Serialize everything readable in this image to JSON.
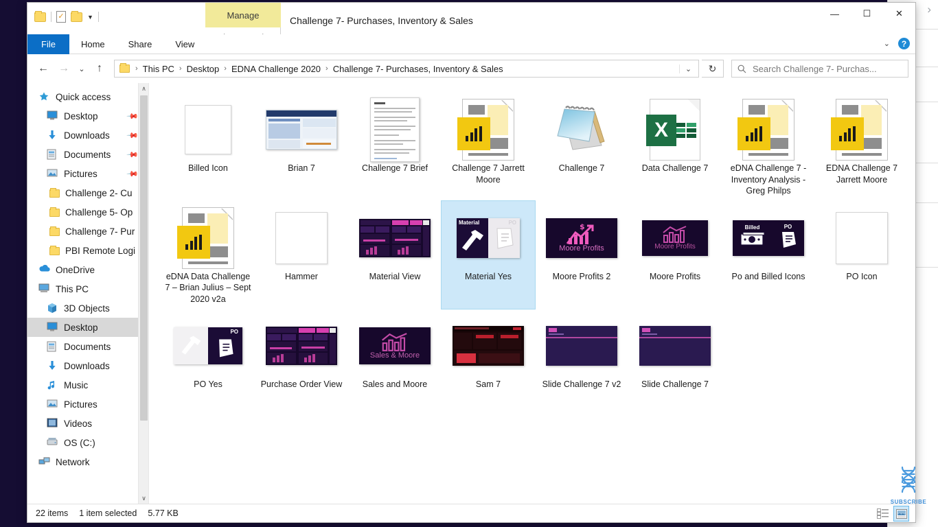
{
  "window": {
    "title": "Challenge 7- Purchases, Inventory & Sales",
    "contextual_tab_group": "Manage",
    "contextual_tab": "Picture Tools",
    "minimize_label": "—",
    "maximize_label": "☐",
    "close_label": "✕",
    "help_label": "?",
    "ribbon_collapse_label": "⌄"
  },
  "quick_access_toolbar": {
    "folder_icon": "folder-icon",
    "properties_icon": "properties-icon",
    "new_folder_icon": "new-folder-icon",
    "customize_caret": "▼"
  },
  "ribbon": {
    "tabs": [
      {
        "label": "File",
        "active": true
      },
      {
        "label": "Home",
        "active": false
      },
      {
        "label": "Share",
        "active": false
      },
      {
        "label": "View",
        "active": false
      }
    ]
  },
  "address_bar": {
    "back_icon": "←",
    "forward_icon": "→",
    "recent_icon": "⌄",
    "up_icon": "↑",
    "refresh_icon": "↻",
    "dropdown_icon": "⌄",
    "breadcrumbs": [
      "This PC",
      "Desktop",
      "EDNA Challenge 2020",
      "Challenge 7- Purchases, Inventory & Sales"
    ],
    "separator": "›"
  },
  "search": {
    "placeholder": "Search Challenge 7- Purchas...",
    "icon": "search-icon"
  },
  "sidebar": {
    "scroll_up": "∧",
    "scroll_down": "∨",
    "items": [
      {
        "label": "Quick access",
        "icon": "star-icon",
        "indent": 0,
        "pinned": false,
        "selected": false
      },
      {
        "label": "Desktop",
        "icon": "desktop-icon",
        "indent": 1,
        "pinned": true,
        "selected": false
      },
      {
        "label": "Downloads",
        "icon": "download-icon",
        "indent": 1,
        "pinned": true,
        "selected": false
      },
      {
        "label": "Documents",
        "icon": "documents-icon",
        "indent": 1,
        "pinned": true,
        "selected": false
      },
      {
        "label": "Pictures",
        "icon": "pictures-icon",
        "indent": 1,
        "pinned": true,
        "selected": false
      },
      {
        "label": "Challenge 2- Cu",
        "icon": "folder-icon",
        "indent": 2,
        "pinned": false,
        "selected": false
      },
      {
        "label": "Challenge 5- Op",
        "icon": "folder-icon",
        "indent": 2,
        "pinned": false,
        "selected": false
      },
      {
        "label": "Challenge 7- Pur",
        "icon": "folder-icon",
        "indent": 2,
        "pinned": false,
        "selected": false
      },
      {
        "label": "PBI Remote Logi",
        "icon": "folder-icon",
        "indent": 2,
        "pinned": false,
        "selected": false
      },
      {
        "label": "OneDrive",
        "icon": "cloud-icon",
        "indent": 0,
        "pinned": false,
        "selected": false
      },
      {
        "label": "This PC",
        "icon": "pc-icon",
        "indent": 0,
        "pinned": false,
        "selected": false
      },
      {
        "label": "3D Objects",
        "icon": "cube-icon",
        "indent": 1,
        "pinned": false,
        "selected": false
      },
      {
        "label": "Desktop",
        "icon": "desktop-icon",
        "indent": 1,
        "pinned": false,
        "selected": true
      },
      {
        "label": "Documents",
        "icon": "documents-icon",
        "indent": 1,
        "pinned": false,
        "selected": false
      },
      {
        "label": "Downloads",
        "icon": "download-icon",
        "indent": 1,
        "pinned": false,
        "selected": false
      },
      {
        "label": "Music",
        "icon": "music-icon",
        "indent": 1,
        "pinned": false,
        "selected": false
      },
      {
        "label": "Pictures",
        "icon": "pictures-icon",
        "indent": 1,
        "pinned": false,
        "selected": false
      },
      {
        "label": "Videos",
        "icon": "video-icon",
        "indent": 1,
        "pinned": false,
        "selected": false
      },
      {
        "label": "OS (C:)",
        "icon": "drive-icon",
        "indent": 1,
        "pinned": false,
        "selected": false
      },
      {
        "label": "Network",
        "icon": "network-icon",
        "indent": 0,
        "pinned": false,
        "selected": false
      }
    ]
  },
  "files": [
    {
      "name": "Billed Icon",
      "icon": "blank-image-icon",
      "selected": false
    },
    {
      "name": "Brian 7",
      "icon": "report-thumb-blue",
      "selected": false
    },
    {
      "name": "Challenge 7 Brief",
      "icon": "document-text-thumb",
      "selected": false
    },
    {
      "name": "Challenge 7 Jarrett Moore",
      "icon": "powerbi-file-icon",
      "selected": false
    },
    {
      "name": "Challenge 7",
      "icon": "notepad-icon",
      "selected": false
    },
    {
      "name": "Data Challenge 7",
      "icon": "excel-file-icon",
      "selected": false
    },
    {
      "name": "eDNA Challenge 7 - Inventory Analysis - Greg Philps",
      "icon": "powerbi-file-icon",
      "selected": false
    },
    {
      "name": "EDNA Challenge 7 Jarrett Moore",
      "icon": "powerbi-file-icon",
      "selected": false
    },
    {
      "name": "eDNA Data Challenge 7 – Brian Julius – Sept 2020 v2a",
      "icon": "powerbi-file-icon",
      "selected": false
    },
    {
      "name": "Hammer",
      "icon": "blank-image-icon",
      "selected": false
    },
    {
      "name": "Material View",
      "icon": "report-thumb-purple",
      "selected": false
    },
    {
      "name": "Material Yes",
      "icon": "material-tool-thumb",
      "selected": true
    },
    {
      "name": "Moore Profits 2",
      "icon": "moore-profits-2-thumb",
      "selected": false
    },
    {
      "name": "Moore Profits",
      "icon": "moore-profits-thumb",
      "selected": false
    },
    {
      "name": "Po and Billed Icons",
      "icon": "po-billed-thumb",
      "selected": false
    },
    {
      "name": "PO Icon",
      "icon": "blank-image-icon",
      "selected": false
    },
    {
      "name": "PO Yes",
      "icon": "po-yes-thumb",
      "selected": false
    },
    {
      "name": "Purchase Order View",
      "icon": "report-thumb-purple",
      "selected": false
    },
    {
      "name": "Sales and Moore",
      "icon": "sales-moore-thumb",
      "selected": false
    },
    {
      "name": "Sam 7",
      "icon": "report-thumb-red",
      "selected": false
    },
    {
      "name": "Slide Challenge 7 v2",
      "icon": "slide-thumb",
      "selected": false
    },
    {
      "name": "Slide Challenge 7",
      "icon": "slide-thumb",
      "selected": false
    }
  ],
  "thumb_text": {
    "material": "Material",
    "po": "PO",
    "billed": "Billed",
    "moore_profits": "Moore Profits",
    "sales_moore": "Sales & Moore"
  },
  "status_bar": {
    "item_count": "22 items",
    "selection": "1 item selected",
    "size": "5.77 KB",
    "details_view_icon": "details-view-icon",
    "large_icons_view_icon": "large-icons-view-icon"
  },
  "background_page": {
    "subscribe_label": "SUBSCRIBE",
    "chevron": "›",
    "dots": "···"
  },
  "colors": {
    "accent": "#0b6ec6",
    "contextual_tab": "#f2ea9a",
    "selection": "#cde8f9",
    "folder_yellow": "#fcd966",
    "powerbi_yellow": "#f2c811",
    "excel_green": "#1d7044",
    "desktop_navy": "#150d33",
    "report_purple": "#17082c",
    "magenta": "#e646b0"
  }
}
